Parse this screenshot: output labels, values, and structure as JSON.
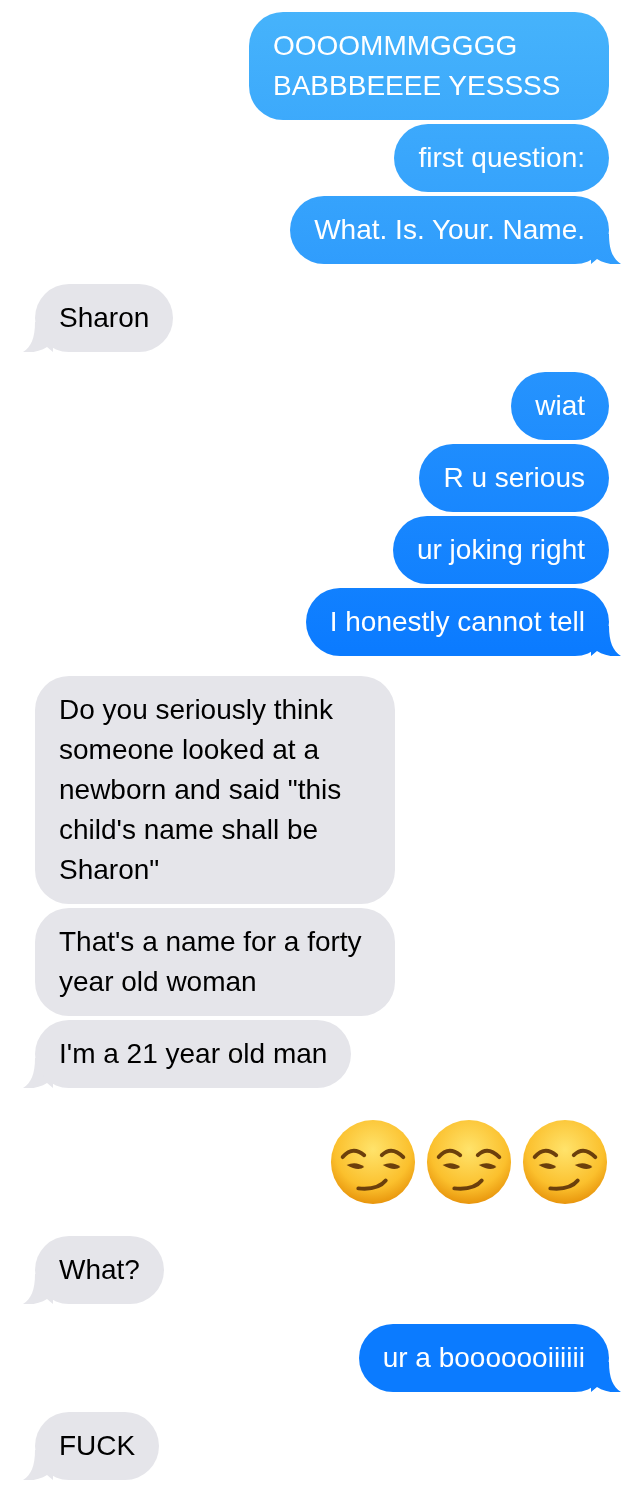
{
  "groups": [
    {
      "outgoing": true,
      "messages": [
        {
          "kind": "text",
          "text": "OOOOMMMGGGG BABBBEEEE YESSSS"
        },
        {
          "kind": "text",
          "text": "first question:"
        },
        {
          "kind": "text",
          "text": "What. Is. Your. Name."
        }
      ]
    },
    {
      "outgoing": false,
      "messages": [
        {
          "kind": "text",
          "text": "Sharon"
        }
      ]
    },
    {
      "outgoing": true,
      "messages": [
        {
          "kind": "text",
          "text": "wiat"
        },
        {
          "kind": "text",
          "text": "R u serious"
        },
        {
          "kind": "text",
          "text": "ur joking right"
        },
        {
          "kind": "text",
          "text": "I honestly cannot tell"
        }
      ]
    },
    {
      "outgoing": false,
      "messages": [
        {
          "kind": "text",
          "text": "Do you seriously think someone looked at a newborn and said \"this child's name shall be Sharon\""
        },
        {
          "kind": "text",
          "text": "That's a name for a forty year old woman"
        },
        {
          "kind": "text",
          "text": "I'm a 21 year old man"
        }
      ]
    },
    {
      "outgoing": true,
      "messages": [
        {
          "kind": "emoji",
          "emojis": [
            {
              "kind": "smirk"
            },
            {
              "kind": "smirk"
            },
            {
              "kind": "smirk"
            }
          ]
        }
      ]
    },
    {
      "outgoing": false,
      "messages": [
        {
          "kind": "text",
          "text": "What?"
        }
      ]
    },
    {
      "outgoing": true,
      "messages": [
        {
          "kind": "text",
          "text": "ur a booooooiiiiii"
        }
      ]
    },
    {
      "outgoing": false,
      "messages": [
        {
          "kind": "text",
          "text": "FUCK"
        }
      ]
    }
  ]
}
